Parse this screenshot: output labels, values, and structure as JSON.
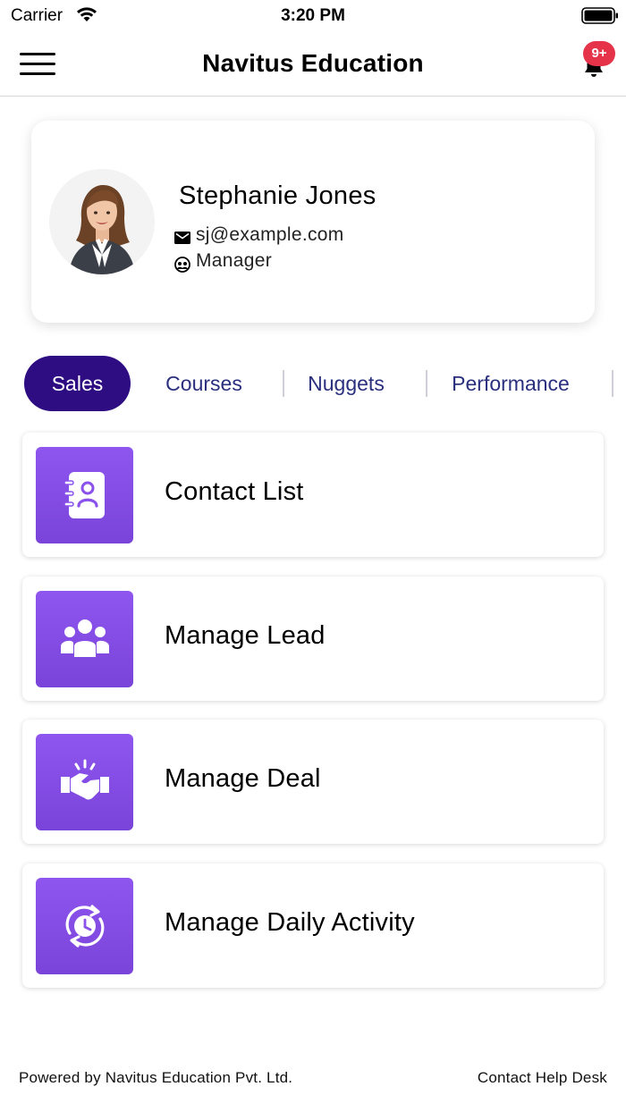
{
  "status_bar": {
    "carrier": "Carrier",
    "time": "3:20 PM"
  },
  "nav": {
    "title": "Navitus Education",
    "notification_badge": "9+",
    "menu_icon": "hamburger-menu-icon",
    "bell_icon": "bell-icon"
  },
  "profile": {
    "name": "Stephanie Jones",
    "email": "sj@example.com",
    "role": "Manager"
  },
  "tabs": [
    {
      "label": "Sales",
      "active": true
    },
    {
      "label": "Courses",
      "active": false
    },
    {
      "label": "Nuggets",
      "active": false
    },
    {
      "label": "Performance",
      "active": false
    }
  ],
  "menu_items": [
    {
      "label": "Contact List",
      "icon": "contact-book-icon"
    },
    {
      "label": "Manage Lead",
      "icon": "group-icon"
    },
    {
      "label": "Manage Deal",
      "icon": "handshake-icon"
    },
    {
      "label": "Manage Daily Activity",
      "icon": "clock-refresh-icon"
    }
  ],
  "footer": {
    "powered_by": "Powered by Navitus Education Pvt. Ltd.",
    "help": "Contact Help Desk"
  },
  "colors": {
    "accent": "#2e0c82",
    "tab_text": "#2a2f7e",
    "icon_gradient_top": "#8e56ef",
    "icon_gradient_bottom": "#7a43d9",
    "badge": "#e5344a"
  }
}
